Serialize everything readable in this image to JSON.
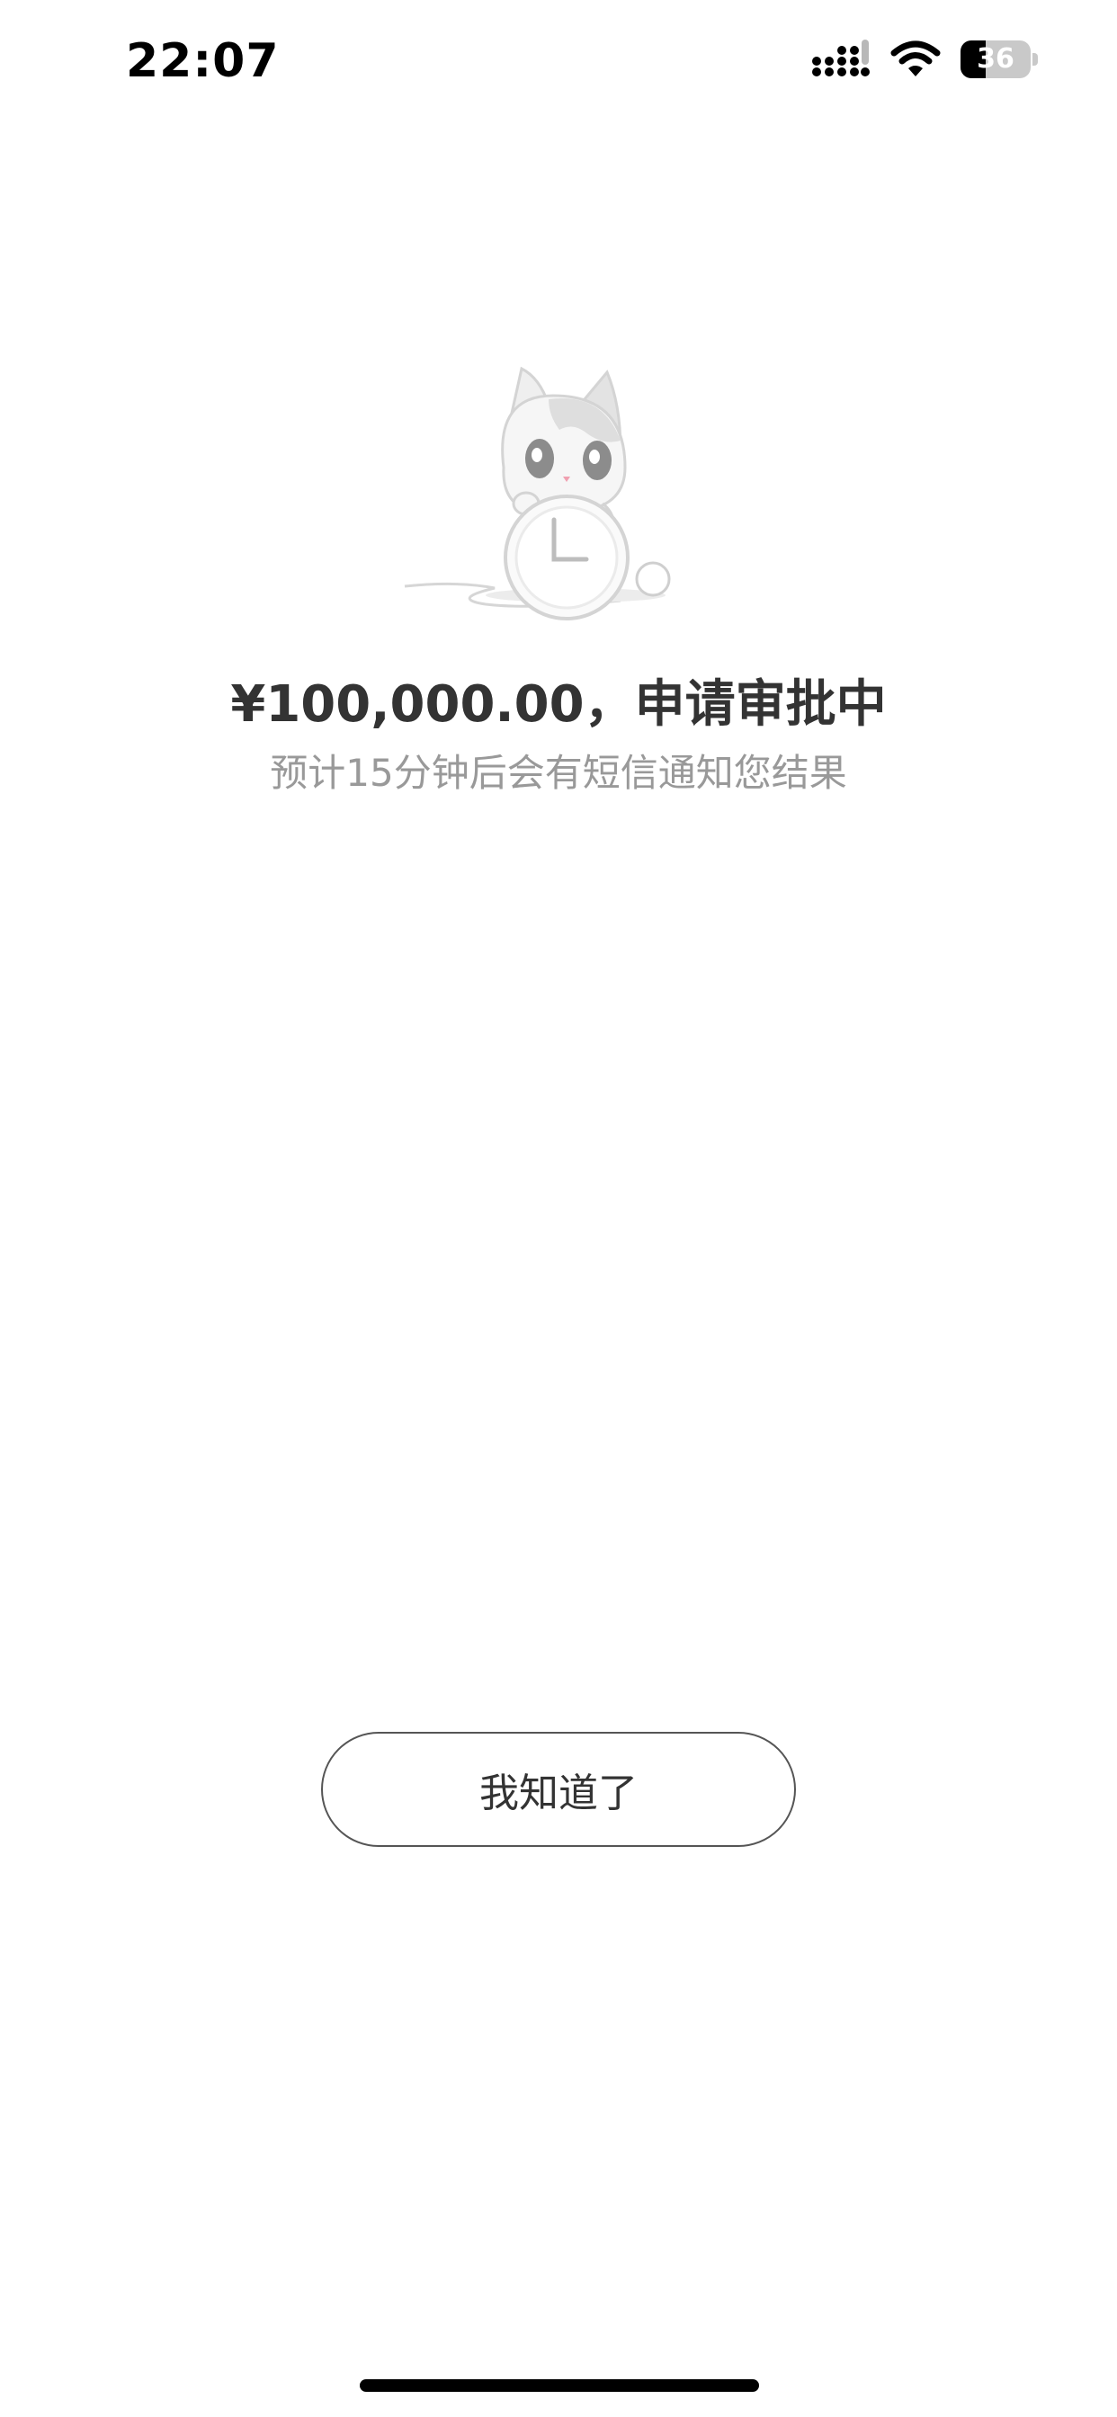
{
  "status_bar": {
    "time": "22:07",
    "battery_level": "36",
    "battery_fraction": 0.36,
    "icons": [
      "signal-icon",
      "wifi-icon",
      "battery-icon"
    ]
  },
  "illustration": {
    "icon": "cat-with-clock-illustration"
  },
  "content": {
    "headline": "¥100,000.00，申请审批中",
    "subline": "预计15分钟后会有短信通知您结果"
  },
  "actions": {
    "confirm_label": "我知道了"
  },
  "colors": {
    "background": "#ffffff",
    "headline": "#333333",
    "subline": "#999999",
    "button_border": "#555555"
  }
}
